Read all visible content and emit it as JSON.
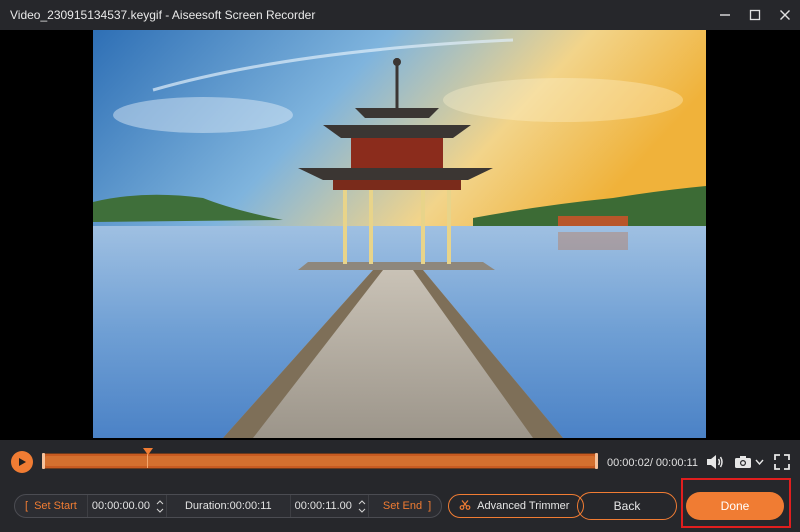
{
  "window": {
    "title": "Video_230915134537.keygif  -  Aiseesoft Screen Recorder"
  },
  "icons": {
    "minimize": "minimize-icon",
    "maximize": "maximize-icon",
    "close": "close-icon",
    "play": "play-icon",
    "volume": "volume-icon",
    "camera": "camera-icon",
    "fullscreen": "fullscreen-icon",
    "scissors": "scissors-icon"
  },
  "colors": {
    "accent": "#f07c33",
    "highlight_box": "#e01e1e"
  },
  "player": {
    "current_time": "00:00:02",
    "total_time": "00:00:11",
    "time_readout": "00:00:02/ 00:00:11"
  },
  "trim": {
    "set_start_label": "Set Start",
    "start_time": "00:00:00.00",
    "duration": "Duration:00:00:11",
    "end_time": "00:00:11.00",
    "set_end_label": "Set End",
    "advanced_trimmer_label": "Advanced Trimmer"
  },
  "actions": {
    "back_label": "Back",
    "done_label": "Done"
  }
}
